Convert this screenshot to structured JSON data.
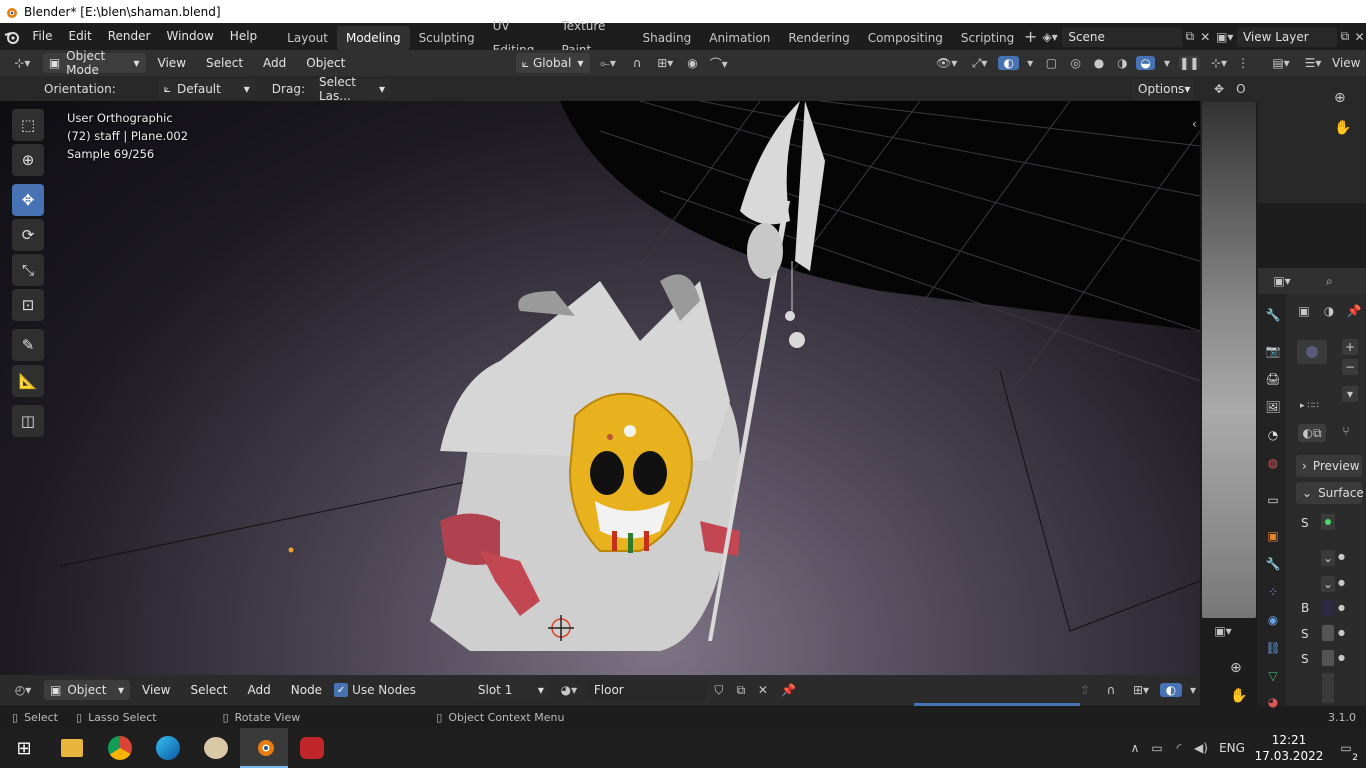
{
  "window": {
    "title": "Blender* [E:\\blen\\shaman.blend]"
  },
  "menu": [
    "File",
    "Edit",
    "Render",
    "Window",
    "Help"
  ],
  "workspaces": [
    "Layout",
    "Modeling",
    "Sculpting",
    "UV Editing",
    "Texture Paint",
    "Shading",
    "Animation",
    "Rendering",
    "Compositing",
    "Scripting"
  ],
  "active_workspace": "Modeling",
  "scene": "Scene",
  "view_layer": "View Layer",
  "header3d": {
    "mode": "Object Mode",
    "view": "View",
    "select": "Select",
    "add": "Add",
    "object": "Object",
    "transform": "Global"
  },
  "toolopts": {
    "orientation_label": "Orientation:",
    "orientation": "Default",
    "drag_label": "Drag:",
    "drag": "Select Las...",
    "options": "Options"
  },
  "overlay": {
    "view": "User Orthographic",
    "object": "(72) staff | Plane.002",
    "sample": "Sample 69/256"
  },
  "node_header": {
    "mode": "Object",
    "view": "View",
    "select": "Select",
    "add": "Add",
    "node": "Node",
    "use_nodes": "Use Nodes",
    "slot": "Slot 1",
    "material": "Floor"
  },
  "mini_view": {
    "view": "View",
    "o": "O"
  },
  "props": {
    "preview": "Preview",
    "surface": "Surface",
    "letters": [
      "S",
      "B",
      "S",
      "S"
    ]
  },
  "status": {
    "select": "Select",
    "lasso": "Lasso Select",
    "rotate": "Rotate View",
    "context": "Object Context Menu",
    "version": "3.1.0"
  },
  "taskbar": {
    "time": "12:21",
    "date": "17.03.2022",
    "lang": "ENG",
    "notifications": "2"
  },
  "colors": {
    "accent": "#4772b3",
    "header": "#303030",
    "bg": "#1d1d1d",
    "mask": "#e8b21e"
  }
}
